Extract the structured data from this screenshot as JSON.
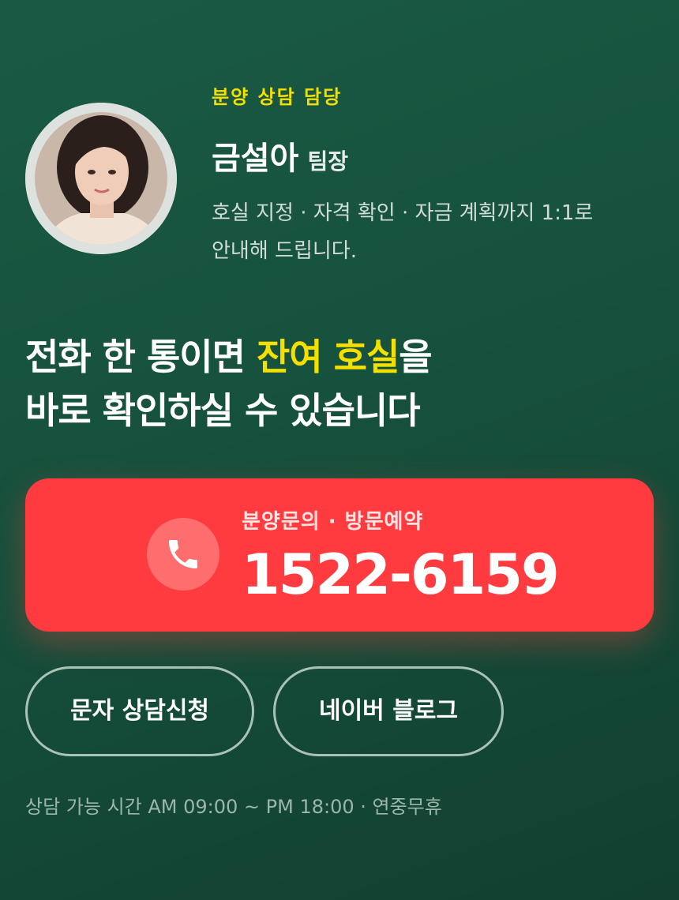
{
  "agent": {
    "role": "분양 상담 담당",
    "name": "금설아",
    "title": "팀장",
    "desc_line1": "호실 지정 · 자격 확인 · 자금 계획까지 1:1로",
    "desc_line2": "안내해 드립니다."
  },
  "headline": {
    "line1_pre": "전화 한 통이면 ",
    "line1_highlight": "잔여 호실",
    "line1_post": "을",
    "line2": "바로 확인하실 수 있습니다"
  },
  "call": {
    "label": "분양문의 · 방문예약",
    "number": "1522-6159",
    "icon": "phone-icon"
  },
  "buttons": {
    "sms": "문자 상담신청",
    "blog": "네이버 블로그"
  },
  "hours": "상담 가능 시간 AM 09:00 ~ PM 18:00 · 연중무휴",
  "colors": {
    "background": "#16513d",
    "accent_yellow": "#f4e000",
    "call_red": "#ff3b3f"
  }
}
